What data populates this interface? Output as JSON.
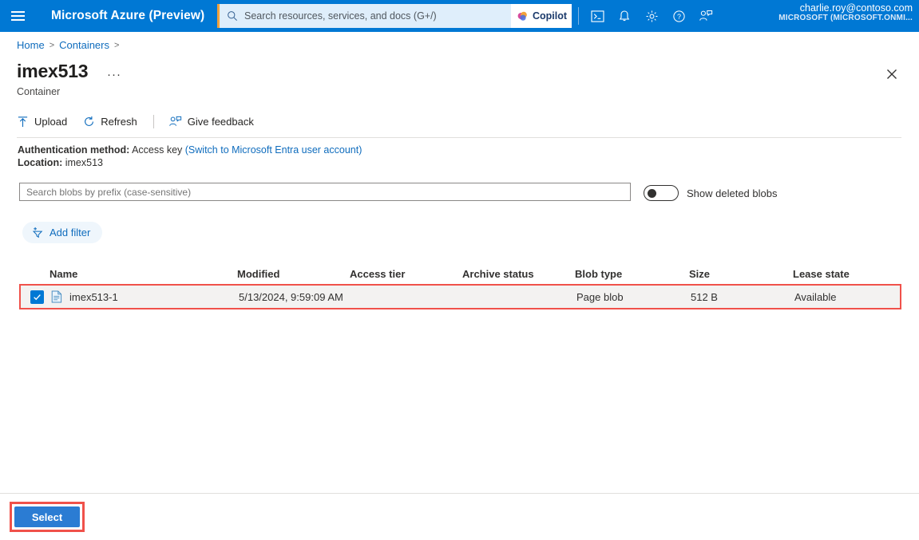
{
  "topbar": {
    "menu_icon": "hamburger-icon",
    "brand": "Microsoft Azure (Preview)",
    "search": {
      "icon": "search-icon",
      "placeholder": "Search resources, services, and docs (G+/)"
    },
    "copilot": {
      "label": "Copilot",
      "icon": "copilot-icon"
    },
    "icons": [
      {
        "name": "cloud-shell-icon"
      },
      {
        "name": "notifications-bell-icon"
      },
      {
        "name": "settings-gear-icon"
      },
      {
        "name": "help-question-icon"
      },
      {
        "name": "feedback-person-icon"
      }
    ],
    "account": {
      "email": "charlie.roy@contoso.com",
      "org": "MICROSOFT (MICROSOFT.ONMI..."
    },
    "accent": "#0078d4"
  },
  "breadcrumb": {
    "items": [
      "Home",
      "Containers"
    ],
    "separator": ">"
  },
  "page": {
    "title": "imex513",
    "ellipsis": "···",
    "subtitle": "Container",
    "close_icon": "close-icon"
  },
  "commandbar": {
    "upload": {
      "label": "Upload",
      "icon": "upload-arrow-icon"
    },
    "refresh": {
      "label": "Refresh",
      "icon": "refresh-icon"
    },
    "feedback": {
      "label": "Give feedback",
      "icon": "feedback-person-icon"
    }
  },
  "info": {
    "auth_label": "Authentication method:",
    "auth_value": "Access key",
    "auth_link": "(Switch to Microsoft Entra user account)",
    "location_label": "Location:",
    "location_value": "imex513"
  },
  "filters": {
    "search_placeholder": "Search blobs by prefix (case-sensitive)",
    "search_value": "",
    "toggle_label": "Show deleted blobs",
    "toggle_state": "off",
    "add_filter_label": "Add filter"
  },
  "table": {
    "columns": [
      "Name",
      "Modified",
      "Access tier",
      "Archive status",
      "Blob type",
      "Size",
      "Lease state"
    ],
    "rows": [
      {
        "selected": true,
        "file_icon": "blob-file-icon",
        "name": "imex513-1",
        "modified": "5/13/2024, 9:59:09 AM",
        "access_tier": "",
        "archive_status": "",
        "blob_type": "Page blob",
        "size": "512 B",
        "lease_state": "Available"
      }
    ]
  },
  "footer": {
    "select_label": "Select"
  },
  "colors": {
    "azure_blue": "#0078d4",
    "highlight_red": "#f0514a",
    "link_blue": "#0f6cbd",
    "row_bg": "#f3f2f1",
    "select_button": "#2b7cd3"
  }
}
